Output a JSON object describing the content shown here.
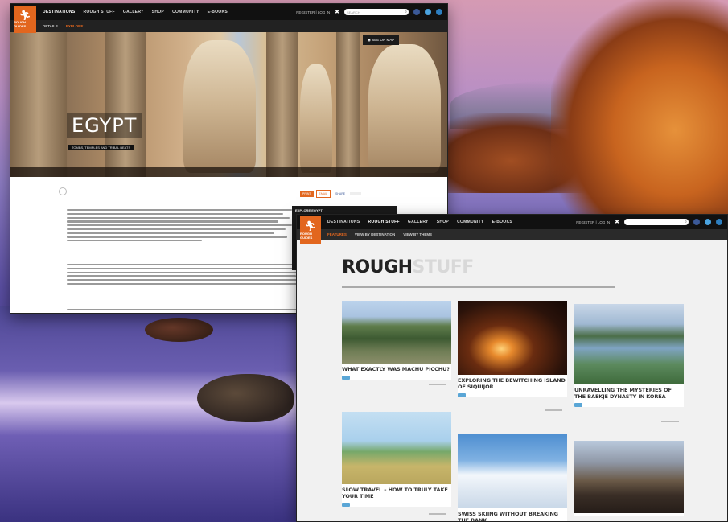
{
  "egypt_page": {
    "nav": {
      "logo_text": "ROUGH GUIDES",
      "items": [
        "DESTINATIONS",
        "ROUGH STUFF",
        "GALLERY",
        "SHOP",
        "COMMUNITY",
        "E-BOOKS"
      ],
      "register": "REGISTER | LOG IN",
      "search_placeholder": "SEARCH"
    },
    "subnav": [
      "DETAILS",
      "EXPLORE"
    ],
    "hero": {
      "title": "EGYPT",
      "subtitle": "TOMBS, TEMPLES AND TRIBAL BEATS",
      "map_button": "SEE ON MAP"
    },
    "toolbar": [
      "PRINT",
      "EMAIL",
      "SHARE"
    ],
    "sidebar": {
      "title": "EXPLORE EGYPT"
    }
  },
  "rough_stuff_page": {
    "nav": {
      "items": [
        "DESTINATIONS",
        "ROUGH STUFF",
        "GALLERY",
        "SHOP",
        "COMMUNITY",
        "E-BOOKS"
      ],
      "register": "REGISTER | LOG IN"
    },
    "subnav": [
      "FEATURES",
      "VIEW BY DESTINATION",
      "VIEW BY THEME"
    ],
    "heading_rough": "ROUGH",
    "heading_stuff": "STUFF",
    "cards": [
      {
        "title": "WHAT EXACTLY WAS MACHU PICCHU?"
      },
      {
        "title": "EXPLORING THE BEWITCHING ISLAND OF SIQUIJOR"
      },
      {
        "title": "UNRAVELLING THE MYSTERIES OF THE BAEKJE DYNASTY IN KOREA"
      },
      {
        "title": "SLOW TRAVEL – HOW TO TRULY TAKE YOUR TIME"
      },
      {
        "title": "SWISS SKIING WITHOUT BREAKING THE BANK"
      },
      {
        "title": ""
      }
    ]
  },
  "colors": {
    "brand_orange": "#e2661e",
    "nav_black": "#111111",
    "tag_blue": "#5aa6d6"
  },
  "icons": [
    "runner-logo-icon",
    "search-icon",
    "facebook-icon",
    "twitter-icon",
    "rss-icon",
    "map-pin-icon"
  ]
}
